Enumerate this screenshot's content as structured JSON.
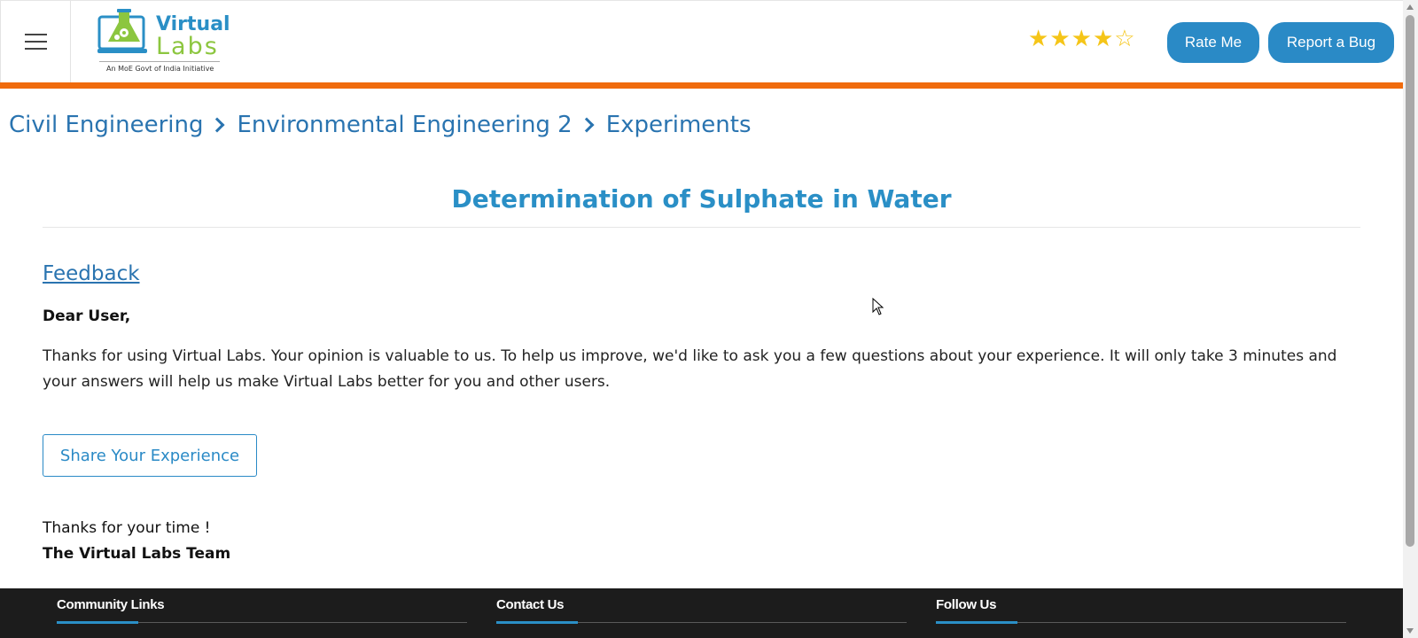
{
  "header": {
    "menu_icon": "hamburger-menu-icon",
    "logo": {
      "line1": "Virtual",
      "line2": "Labs",
      "tagline": "An MoE Govt of India Initiative"
    },
    "rating": {
      "filled": 4,
      "max": 5,
      "color": "#f5c518"
    },
    "rate_button": "Rate Me",
    "bug_button": "Report a Bug",
    "accent_bar_color": "#f06b0d",
    "button_color": "#2a8ac6"
  },
  "breadcrumb": {
    "items": [
      "Civil Engineering",
      "Environmental Engineering 2",
      "Experiments"
    ]
  },
  "main": {
    "title": "Determination of Sulphate in Water",
    "feedback_heading": "Feedback",
    "greeting": "Dear User,",
    "message": "Thanks for using Virtual Labs. Your opinion is valuable to us. To help us improve, we'd like to ask you a few questions about your experience. It will only take 3 minutes and your answers will help us make Virtual Labs better for you and other users.",
    "share_button": "Share Your Experience",
    "thanks": "Thanks for your time !",
    "signoff": "The Virtual Labs Team"
  },
  "footer": {
    "columns": [
      "Community Links",
      "Contact Us",
      "Follow Us"
    ]
  }
}
